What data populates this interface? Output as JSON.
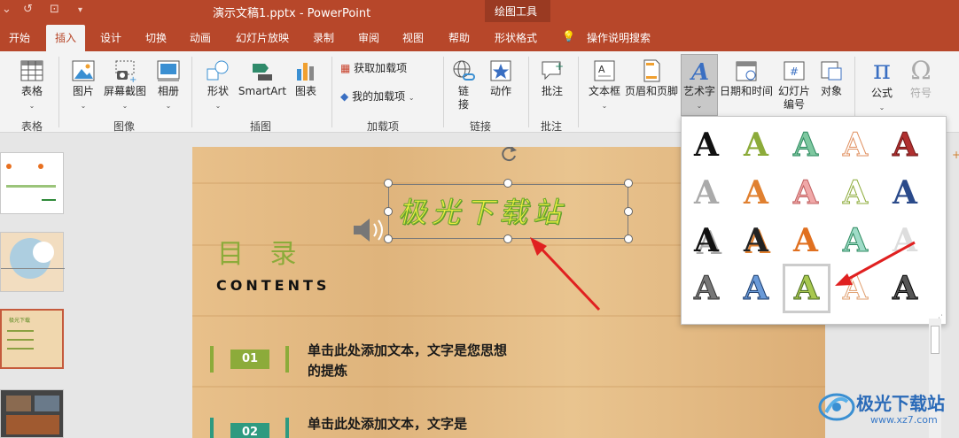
{
  "window": {
    "title": "演示文稿1.pptx  -  PowerPoint",
    "context_group": "绘图工具"
  },
  "tabs": [
    "开始",
    "插入",
    "设计",
    "切换",
    "动画",
    "幻灯片放映",
    "录制",
    "审阅",
    "视图",
    "帮助",
    "形状格式"
  ],
  "active_tab": "插入",
  "search_label": "操作说明搜索",
  "ribbon": {
    "groups": [
      "表格",
      "图像",
      "插图",
      "加载项",
      "链接",
      "批注"
    ],
    "buttons": {
      "table": "表格",
      "picture": "图片",
      "screenshot": "屏幕截图",
      "album": "相册",
      "shapes": "形状",
      "smartart": "SmartArt",
      "chart": "图表",
      "get_addins": "获取加载项",
      "my_addins": "我的加载项",
      "link": "链接",
      "action": "动作",
      "comment": "批注",
      "textbox": "文本框",
      "header_footer": "页眉和页脚",
      "wordart": "艺术字",
      "datetime": "日期和时间",
      "slide_number": "幻灯片编号",
      "object": "对象",
      "equation": "公式",
      "symbol": "符号"
    }
  },
  "slide": {
    "wordart_text": "极光下载站",
    "heading": "目 录",
    "subheading": "CONTENTS",
    "items": [
      {
        "num": "01",
        "text": "单击此处添加文本，文字是您思想的提炼"
      },
      {
        "num": "02",
        "text": "单击此处添加文本，文字是"
      }
    ]
  },
  "thumb3_title": "极光下载",
  "watermark": {
    "text": "极光下载站",
    "url": "www.xz7.com"
  },
  "colors": {
    "accent": "#b7472a",
    "slide_green": "#8cab3a"
  }
}
